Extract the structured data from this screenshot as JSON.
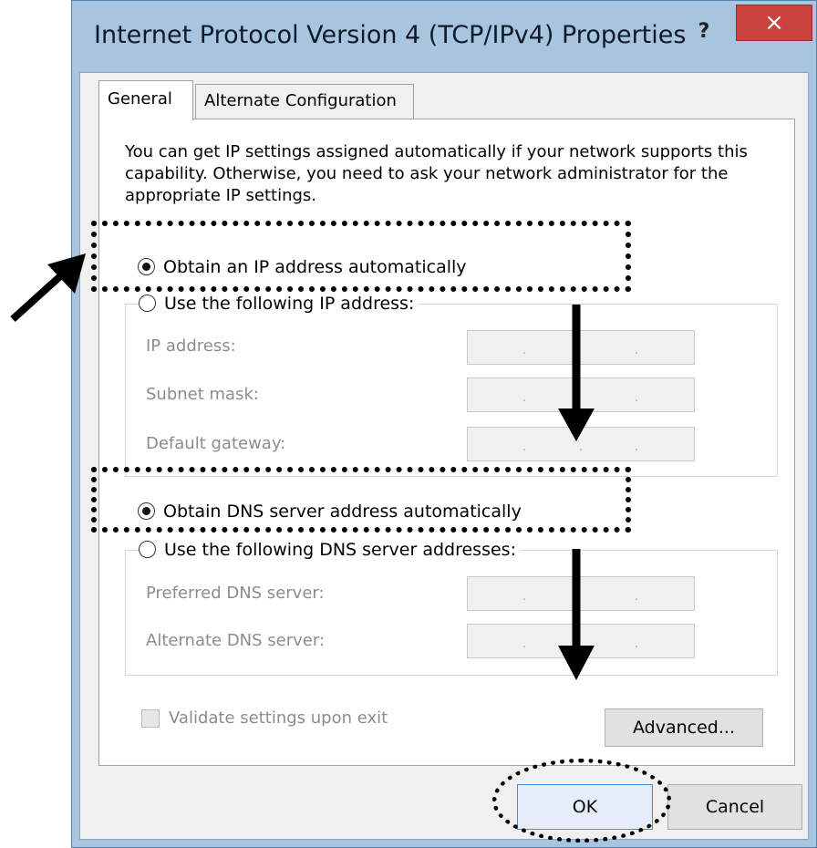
{
  "window": {
    "title": "Internet Protocol Version 4 (TCP/IPv4) Properties",
    "help_label": "?",
    "close_label": "×"
  },
  "tabs": [
    {
      "label": "General",
      "active": true
    },
    {
      "label": "Alternate Configuration",
      "active": false
    }
  ],
  "description": "You can get IP settings assigned automatically if your network supports this capability. Otherwise, you need to ask your network administrator for the appropriate IP settings.",
  "ip_section": {
    "auto_label": "Obtain an IP address automatically",
    "auto_selected": true,
    "manual_label": "Use the following IP address:",
    "fields": [
      {
        "label": "IP address:",
        "value": ". ."
      },
      {
        "label": "Subnet mask:",
        "value": ". ."
      },
      {
        "label": "Default gateway:",
        "value": ". . ."
      }
    ]
  },
  "dns_section": {
    "auto_label": "Obtain DNS server address automatically",
    "auto_selected": true,
    "manual_label": "Use the following DNS server addresses:",
    "fields": [
      {
        "label": "Preferred DNS server:",
        "value": ". ."
      },
      {
        "label": "Alternate DNS server:",
        "value": ". ."
      }
    ]
  },
  "validate_label": "Validate settings upon exit",
  "validate_checked": false,
  "buttons": {
    "advanced": "Advanced...",
    "ok": "OK",
    "cancel": "Cancel"
  },
  "colors": {
    "title_bar": "#a8c5e0",
    "close_button": "#c8433e",
    "ok_focus_border": "#3c8ee0"
  }
}
